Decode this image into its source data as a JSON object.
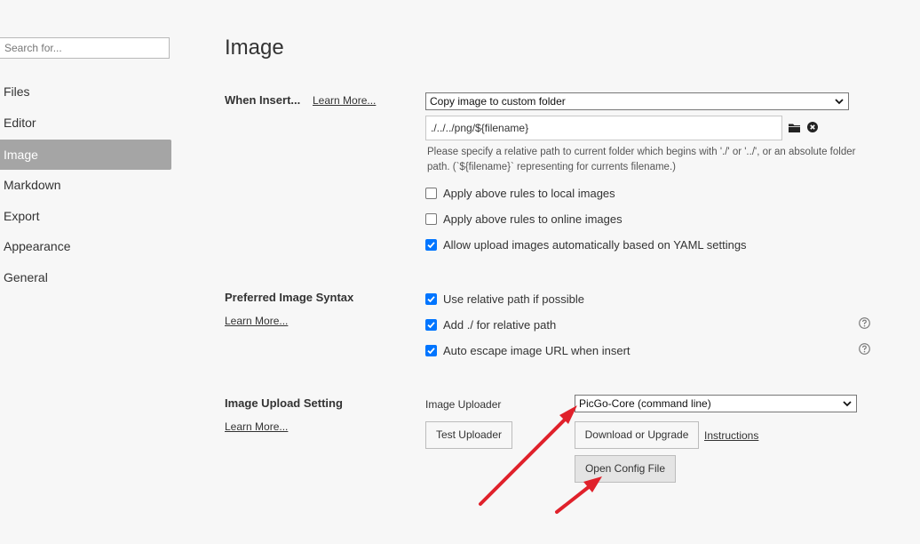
{
  "sidebar": {
    "search_placeholder": "Search for...",
    "items": [
      {
        "label": "Files"
      },
      {
        "label": "Editor"
      },
      {
        "label": "Image",
        "active": true
      },
      {
        "label": "Markdown"
      },
      {
        "label": "Export"
      },
      {
        "label": "Appearance"
      },
      {
        "label": "General"
      }
    ]
  },
  "main": {
    "title": "Image",
    "when_insert": {
      "label": "When Insert...",
      "learn_more": "Learn More...",
      "action_select": "Copy image to custom folder",
      "path_value": "./../../png/${filename}",
      "hint": "Please specify a relative path to current folder which begins with './' or '../', or an absolute folder path. (`${filename}` representing for currents filename.)",
      "options": [
        {
          "label": "Apply above rules to local images",
          "checked": false
        },
        {
          "label": "Apply above rules to online images",
          "checked": false
        },
        {
          "label": "Allow upload images automatically based on YAML settings",
          "checked": true
        }
      ]
    },
    "syntax": {
      "label": "Preferred Image Syntax",
      "learn_more": "Learn More...",
      "options": [
        {
          "label": "Use relative path if possible",
          "checked": true
        },
        {
          "label": "Add ./ for relative path",
          "checked": true
        },
        {
          "label": "Auto escape image URL when insert",
          "checked": true
        }
      ]
    },
    "upload": {
      "label": "Image Upload Setting",
      "learn_more": "Learn More...",
      "uploader_label": "Image Uploader",
      "uploader_select": "PicGo-Core (command line)",
      "test_button": "Test Uploader",
      "download_button": "Download or Upgrade",
      "instructions_link": "Instructions",
      "open_config_button": "Open Config File"
    }
  },
  "colors": {
    "active_nav": "#a5a5a5",
    "checkbox": "#0075ff",
    "annotation_arrow": "#e0212b"
  }
}
